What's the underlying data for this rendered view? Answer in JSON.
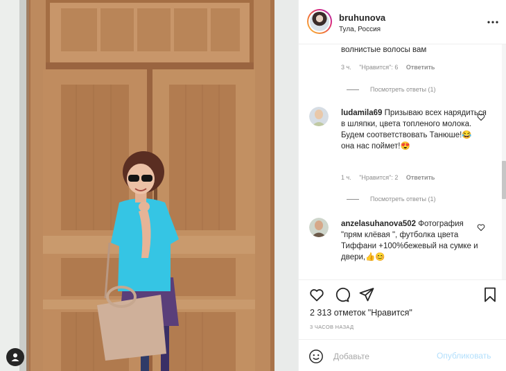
{
  "post": {
    "username": "bruhunova",
    "location": "Тула, Россия",
    "more_label": "•••"
  },
  "comments": [
    {
      "id": "c0",
      "username": "",
      "text": "волнистые волосы вам",
      "time": "3 ч.",
      "likes": "\"Нравится\": 6",
      "reply_label": "Ответить",
      "view_replies": "Посмотреть ответы (1)"
    },
    {
      "id": "c1",
      "username": "ludamila69",
      "text": "Призываю всех нарядиться в шляпки, цвета топленого молока. Будем соответствовать Танюше!😂 она нас поймет!😍",
      "time": "1 ч.",
      "likes": "\"Нравится\": 2",
      "reply_label": "Ответить",
      "view_replies": "Посмотреть ответы (1)"
    },
    {
      "id": "c2",
      "username": "anzelasuhanova502",
      "text": "Фотография \"прям клёвая \", футболка цвета Тиффани +100%бежевый на сумке и двери,👍😊",
      "time": "",
      "likes": "",
      "reply_label": "",
      "view_replies": ""
    }
  ],
  "actions": {
    "likes_count": "2 313 отметок \"Нравится\"",
    "time_ago": "3 часов назад"
  },
  "add_comment": {
    "placeholder": "Добавьте",
    "publish_label": "Опубликовать"
  },
  "icons": {
    "like": "heart-icon",
    "comment": "comment-icon",
    "share": "paper-plane-icon",
    "save": "bookmark-icon",
    "emoji": "smiley-icon",
    "more": "more-dots-icon",
    "user_tag": "user-tag-icon"
  },
  "colors": {
    "text": "#262626",
    "muted": "#8e8e8e",
    "publish_disabled": "#b2dffc",
    "door": "#b9855a",
    "shirt": "#33c6e6"
  }
}
